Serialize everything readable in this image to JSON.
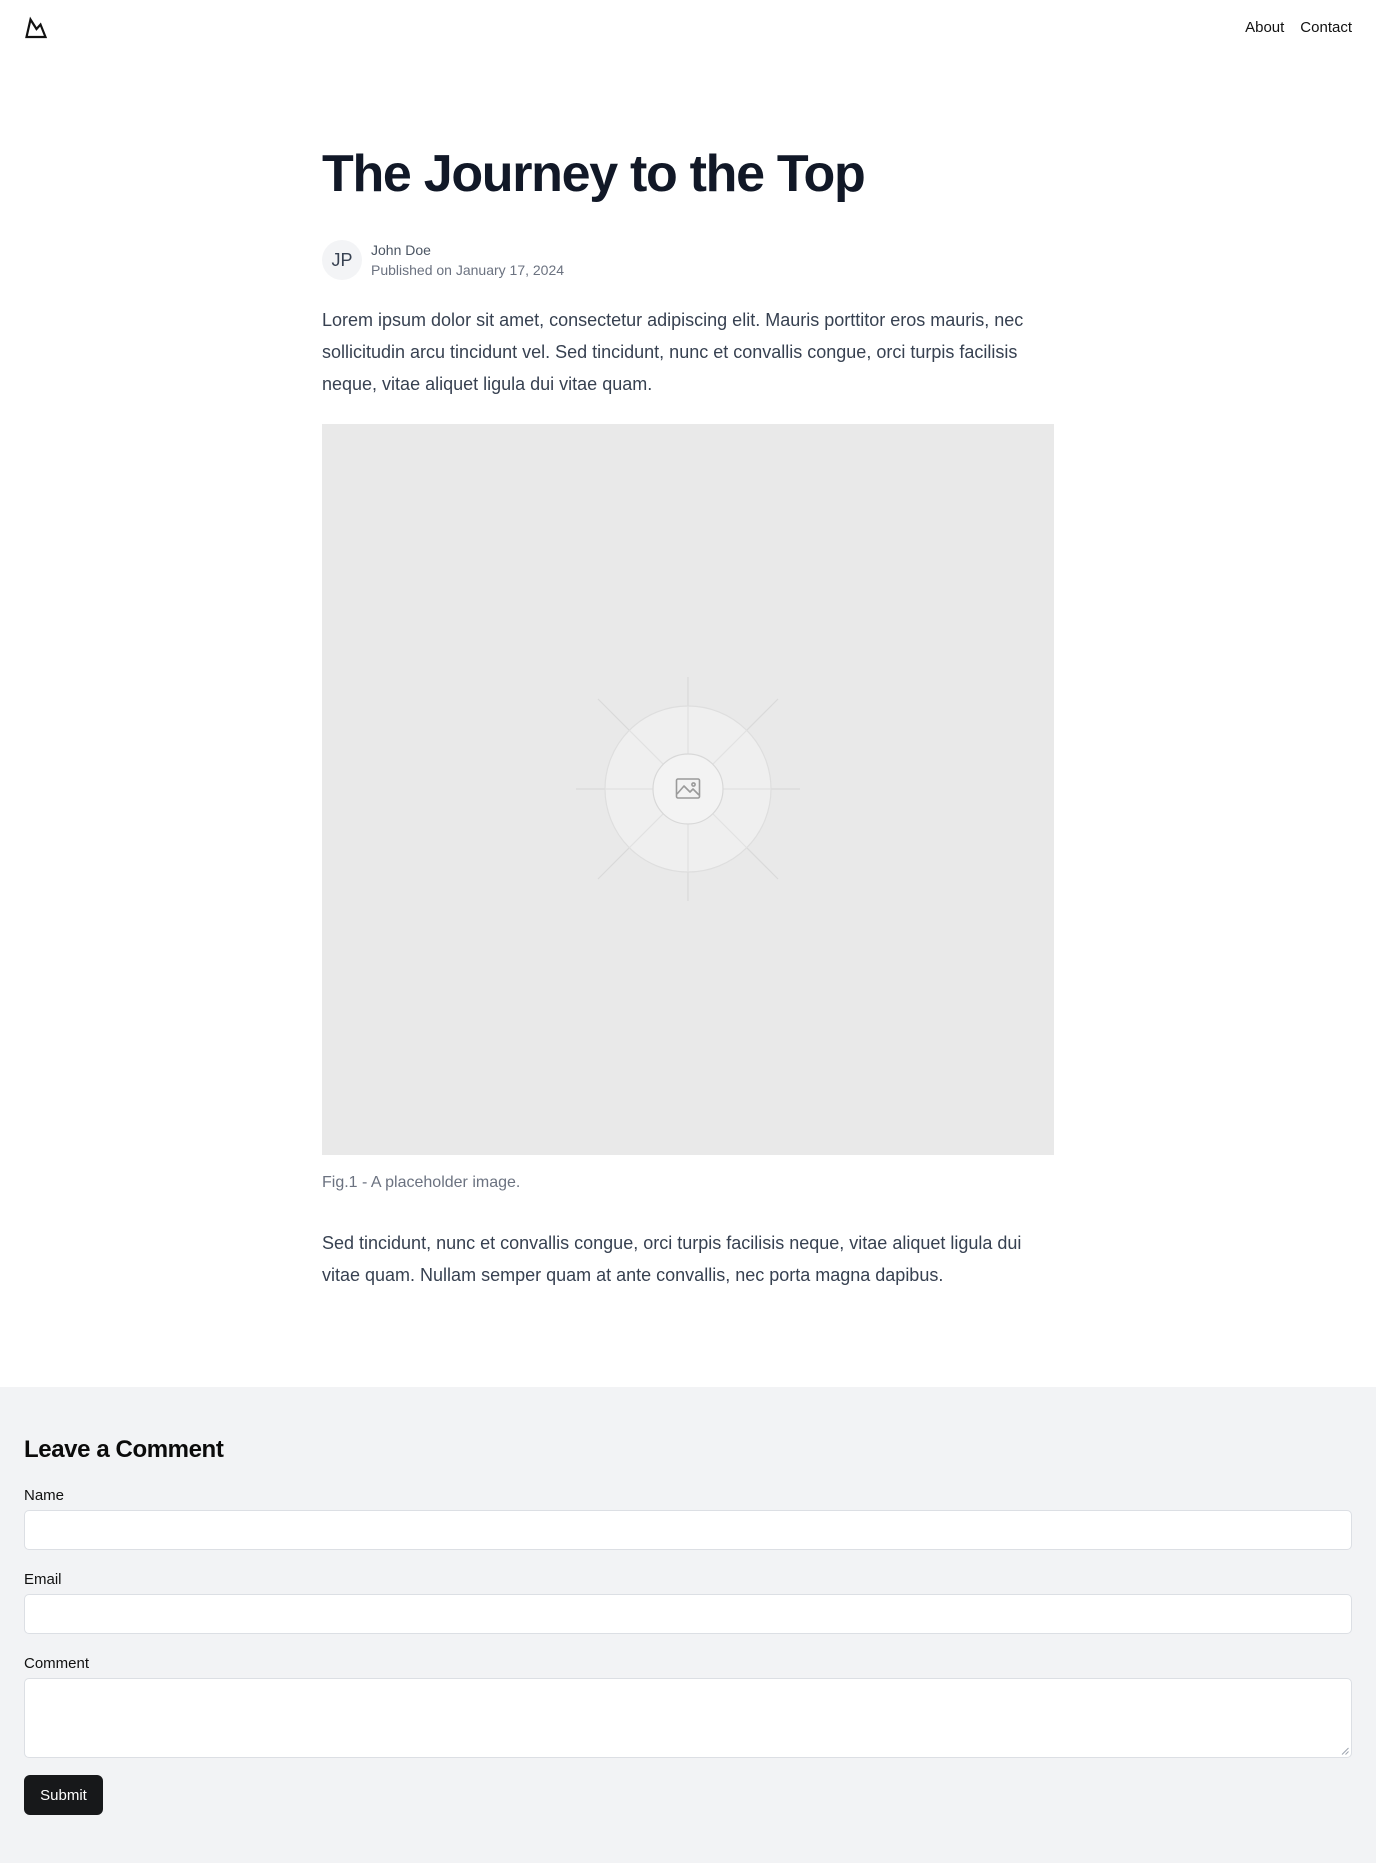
{
  "nav": {
    "about": "About",
    "contact": "Contact"
  },
  "article": {
    "title": "The Journey to the Top",
    "author_initials": "JP",
    "author_name": "John Doe",
    "published": "Published on January 17, 2024",
    "paragraph1": "Lorem ipsum dolor sit amet, consectetur adipiscing elit. Mauris porttitor eros mauris, nec sollicitudin arcu tincidunt vel. Sed tincidunt, nunc et convallis congue, orci turpis facilisis neque, vitae aliquet ligula dui vitae quam.",
    "caption": "Fig.1 - A placeholder image.",
    "paragraph2": "Sed tincidunt, nunc et convallis congue, orci turpis facilisis neque, vitae aliquet ligula dui vitae quam. Nullam semper quam at ante convallis, nec porta magna dapibus."
  },
  "comment_form": {
    "heading": "Leave a Comment",
    "name_label": "Name",
    "name_value": "",
    "email_label": "Email",
    "email_value": "",
    "comment_label": "Comment",
    "comment_value": "",
    "submit_label": "Submit"
  },
  "icons": {
    "logo": "mountain-logo-icon",
    "figure": "image-placeholder-icon",
    "resize": "resize-grip-icon"
  }
}
